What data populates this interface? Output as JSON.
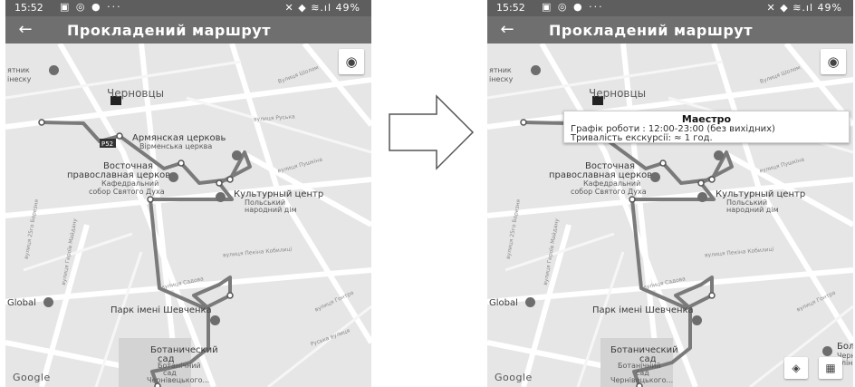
{
  "status_bar": {
    "time": "15:52",
    "left_icons": "▣ ◎ ● ···",
    "right_icons": "✕ ◆ ≋.ıl",
    "battery": "49%"
  },
  "app_bar": {
    "back_icon": "arrow-left-icon",
    "back_glyph": "←",
    "title": "Прокладений маршрут"
  },
  "map": {
    "city_label": "Черновцы",
    "places": [
      {
        "key": "p1a",
        "text": "ятник"
      },
      {
        "key": "p1b",
        "text": "інеску"
      },
      {
        "key": "armenian1",
        "text": "Армянская церковь"
      },
      {
        "key": "armenian2",
        "text": "Вірменська церква"
      },
      {
        "key": "orthodox1",
        "text": "Восточная"
      },
      {
        "key": "orthodox2",
        "text": "православная церковь"
      },
      {
        "key": "orthodox3",
        "text": "Кафедральний"
      },
      {
        "key": "orthodox4",
        "text": "собор Святого Духа"
      },
      {
        "key": "culture1",
        "text": "Культурный центр"
      },
      {
        "key": "culture2",
        "text": "Польський"
      },
      {
        "key": "culture3",
        "text": "народний дім"
      },
      {
        "key": "global",
        "text": "Global"
      },
      {
        "key": "park",
        "text": "Парк імені Шевченка"
      },
      {
        "key": "bot1",
        "text": "Ботанический"
      },
      {
        "key": "bot2",
        "text": "сад"
      },
      {
        "key": "bot3",
        "text": "Ботанічний"
      },
      {
        "key": "bot4",
        "text": "сад"
      },
      {
        "key": "bot5",
        "text": "Чернівецького..."
      },
      {
        "key": "bol1",
        "text": "Бол"
      },
      {
        "key": "bol2",
        "text": "Черн"
      },
      {
        "key": "bol3",
        "text": "клін"
      }
    ],
    "streets": [
      {
        "key": "s1",
        "text": "вулиця Руська"
      },
      {
        "key": "s2",
        "text": "вулиця Пекіна Кобилиці"
      },
      {
        "key": "s3",
        "text": "вулиця Садова"
      },
      {
        "key": "s4",
        "text": "вулиця Гонтра"
      },
      {
        "key": "s5",
        "text": "Вулиця Шолом"
      },
      {
        "key": "s6",
        "text": "вулиця 25го Березня"
      },
      {
        "key": "s7",
        "text": "вулиця Героїв Майдану"
      },
      {
        "key": "s8",
        "text": "Руська вулиця"
      },
      {
        "key": "s9",
        "text": "вулиця Пушкіна"
      }
    ],
    "route_badge": "P52",
    "locate_icon": "my-location-icon",
    "locate_glyph": "◉",
    "google_logo": "Google"
  },
  "info_window": {
    "title": "Маестро",
    "schedule": "Графік роботи : 12:00-23:00 (без вихідних)",
    "duration": "Тривалість екскурсії: ≈ 1 год."
  },
  "map_toolbar": {
    "directions_icon": "directions-icon",
    "directions_glyph": "◈",
    "open_maps_icon": "open-in-maps-icon",
    "open_maps_glyph": "▦"
  },
  "transition_arrow_icon": "arrow-right-icon"
}
